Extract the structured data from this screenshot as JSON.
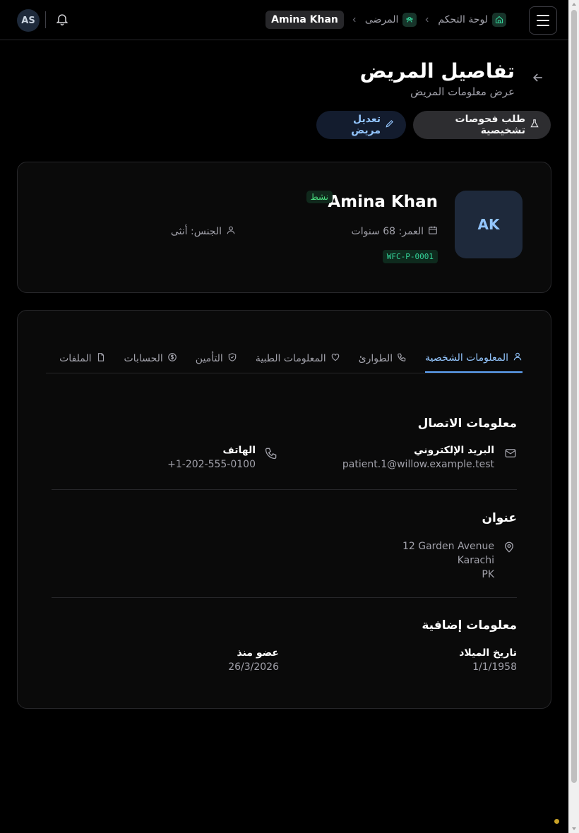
{
  "header": {
    "user_initials": "AS",
    "breadcrumbs": [
      "لوحة التحكم",
      "المرضى",
      "Amina Khan"
    ]
  },
  "page": {
    "title": "تفاصيل المريض",
    "subtitle": "عرض معلومات المريض",
    "actions": {
      "request_tests": "طلب فحوصات تشخيصية",
      "edit_patient": "تعديل مريض"
    }
  },
  "patient": {
    "initials": "AK",
    "name": "Amina Khan",
    "status": "نشط",
    "age": "العمر: 68 سنوات",
    "gender": "الجنس: أنثى",
    "patient_id": "WFC-P-0001"
  },
  "tabs": [
    "المعلومات الشخصية",
    "الطوارئ",
    "المعلومات الطبية",
    "التأمين",
    "الحسابات",
    "الملفات"
  ],
  "active_tab": "المعلومات الشخصية",
  "contact": {
    "title": "معلومات الاتصال",
    "email_label": "البريد الإلكتروني",
    "email": "patient.1@willow.example.test",
    "phone_label": "الهاتف",
    "phone": "+1-202-555-0100"
  },
  "address": {
    "title": "عنوان",
    "line1": "12 Garden Avenue",
    "city": "Karachi",
    "country": "PK"
  },
  "additional": {
    "title": "معلومات إضافية",
    "dob_label": "تاريخ الميلاد",
    "dob": "1/1/1958",
    "member_label": "عضو منذ",
    "member_since": "26/3/2026"
  },
  "colors": {
    "accent": "#60a5fa",
    "success": "#4ade80",
    "background": "#000000"
  }
}
